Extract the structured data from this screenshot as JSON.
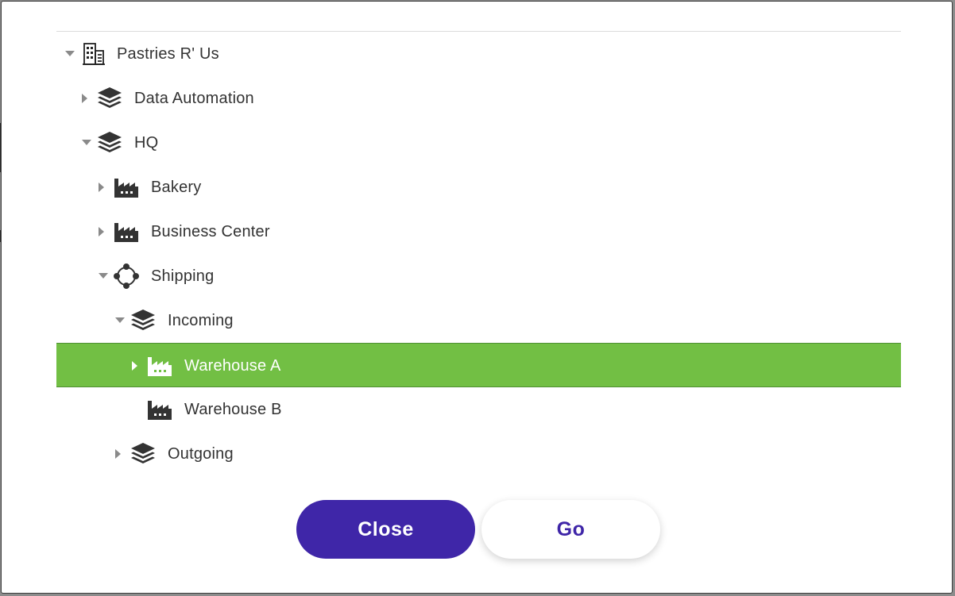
{
  "tree": {
    "nodes": [
      {
        "label": "Pastries R' Us",
        "icon": "building-icon",
        "toggle": "expanded"
      },
      {
        "label": "Data Automation",
        "icon": "layers-icon",
        "toggle": "collapsed"
      },
      {
        "label": "HQ",
        "icon": "layers-icon",
        "toggle": "expanded"
      },
      {
        "label": "Bakery",
        "icon": "factory-icon",
        "toggle": "collapsed"
      },
      {
        "label": "Business Center",
        "icon": "factory-icon",
        "toggle": "collapsed"
      },
      {
        "label": "Shipping",
        "icon": "circle-nodes-icon",
        "toggle": "expanded"
      },
      {
        "label": "Incoming",
        "icon": "layers-icon",
        "toggle": "expanded"
      },
      {
        "label": "Warehouse A",
        "icon": "factory-icon",
        "toggle": "collapsed",
        "selected": true
      },
      {
        "label": "Warehouse B",
        "icon": "factory-icon",
        "toggle": "none"
      },
      {
        "label": "Outgoing",
        "icon": "layers-icon",
        "toggle": "collapsed"
      }
    ]
  },
  "buttons": {
    "close_label": "Close",
    "go_label": "Go"
  },
  "colors": {
    "selected_row": "#72bf44",
    "primary_button": "#3f26a8",
    "text": "#333333"
  }
}
